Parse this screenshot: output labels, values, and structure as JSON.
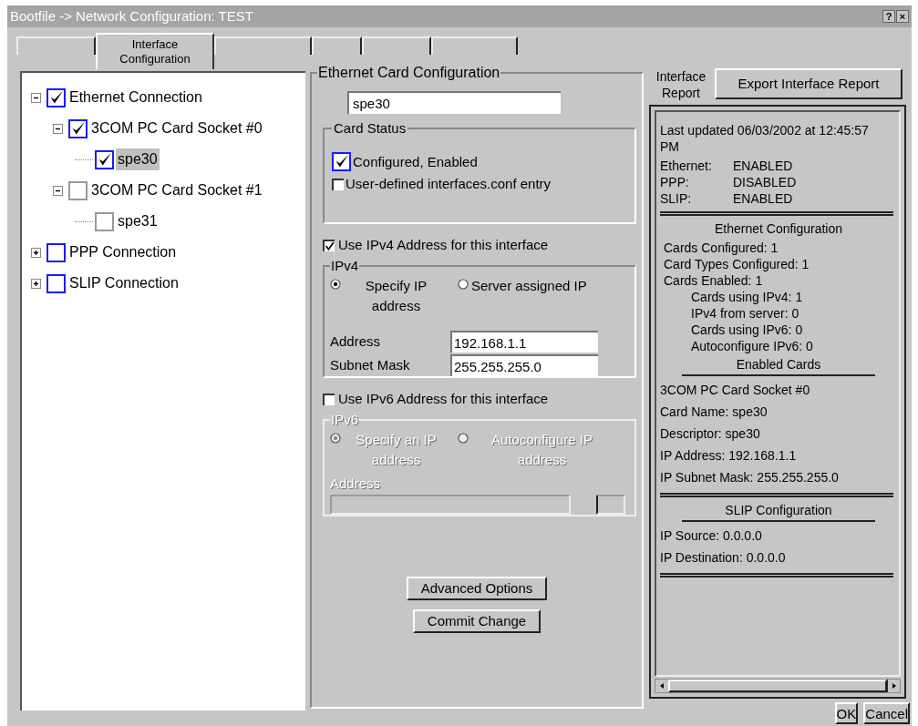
{
  "window": {
    "title": "Bootfile -> Network Configuration: TEST",
    "controls": [
      "?",
      "×"
    ]
  },
  "tabs": [
    {
      "selected": false
    },
    {
      "label": "Interface Configuration",
      "selected": true
    },
    {
      "selected": false
    },
    {
      "selected": false
    },
    {
      "selected": false
    },
    {
      "selected": false
    }
  ],
  "tree": [
    {
      "label": "Ethernet Connection",
      "checked": true,
      "expanded": true,
      "disabled": false,
      "selected": false,
      "children": [
        {
          "label": "3COM PC Card Socket #0",
          "checked": true,
          "expanded": true,
          "disabled": false,
          "selected": false,
          "children": [
            {
              "label": "spe30",
              "checked": true,
              "disabled": false,
              "selected": true
            }
          ]
        },
        {
          "label": "3COM PC Card Socket #1",
          "checked": false,
          "expanded": true,
          "disabled": true,
          "selected": false,
          "children": [
            {
              "label": "spe31",
              "checked": false,
              "disabled": true,
              "selected": false
            }
          ]
        }
      ]
    },
    {
      "label": "PPP Connection",
      "checked": false,
      "expanded": false,
      "disabled": false,
      "selected": false
    },
    {
      "label": "SLIP Connection",
      "checked": false,
      "expanded": false,
      "disabled": false,
      "selected": false
    }
  ],
  "card_config": {
    "title": "Ethernet Card Configuration",
    "name_value": "spe30",
    "card_status": {
      "title": "Card Status",
      "options": [
        {
          "label": "Configured, Enabled",
          "checked": true
        },
        {
          "label": "User-defined interfaces.conf entry",
          "checked": false
        }
      ]
    },
    "ipv4": {
      "toggle": "Use IPv4 Address for this interface",
      "checked": true,
      "title": "IPv4",
      "disabled": false,
      "radios": [
        {
          "label": "Specify IP address",
          "selected": true
        },
        {
          "label": "Server assigned IP",
          "selected": false
        }
      ],
      "fields": [
        {
          "label": "Address",
          "value": "192.168.1.1"
        },
        {
          "label": "Subnet Mask",
          "value": "255.255.255.0"
        }
      ]
    },
    "ipv6": {
      "toggle": "Use IPv6 Address for this interface",
      "checked": false,
      "title": "IPv6",
      "disabled": true,
      "radios": [
        {
          "label": "Specify an IP address",
          "selected": true
        },
        {
          "label": "Autoconfigure IP address",
          "selected": false
        }
      ],
      "address_label": "Address"
    },
    "buttons": [
      "Advanced Options",
      "Commit Change"
    ]
  },
  "report": {
    "label": "Interface Report",
    "export_button": "Export Interface Report",
    "lines": [
      {
        "kind": "text",
        "text": "Last updated 06/03/2002 at 12:45:57 PM"
      },
      {
        "kind": "status",
        "label": "Ethernet:",
        "value": "ENABLED"
      },
      {
        "kind": "status",
        "label": "PPP:",
        "value": "DISABLED"
      },
      {
        "kind": "status",
        "label": "SLIP:",
        "value": "ENABLED"
      },
      {
        "kind": "rule"
      },
      {
        "kind": "heading",
        "text": "Ethernet Configuration"
      },
      {
        "kind": "item",
        "text": "Cards Configured: 1"
      },
      {
        "kind": "item",
        "text": "Card Types Configured: 1"
      },
      {
        "kind": "item",
        "text": "Cards Enabled: 1"
      },
      {
        "kind": "subitem",
        "text": "Cards using IPv4: 1"
      },
      {
        "kind": "subitem",
        "text": "IPv4 from server: 0"
      },
      {
        "kind": "subitem",
        "text": "Cards using IPv6: 0"
      },
      {
        "kind": "subitem",
        "text": "Autoconfigure IPv6: 0"
      },
      {
        "kind": "subheading",
        "text": "Enabled Cards"
      },
      {
        "kind": "text",
        "text": "3COM PC Card Socket #0"
      },
      {
        "kind": "text",
        "text": "Card Name: spe30"
      },
      {
        "kind": "text",
        "text": "Descriptor: spe30"
      },
      {
        "kind": "text",
        "text": "IP Address: 192.168.1.1"
      },
      {
        "kind": "text",
        "text": "IP Subnet Mask: 255.255.255.0"
      },
      {
        "kind": "rule"
      },
      {
        "kind": "subheading",
        "text": "SLIP Configuration"
      },
      {
        "kind": "text",
        "text": "IP Source: 0.0.0.0"
      },
      {
        "kind": "text",
        "text": "IP Destination: 0.0.0.0"
      },
      {
        "kind": "rule"
      }
    ]
  },
  "dialog_buttons": [
    "OK",
    "Cancel"
  ]
}
